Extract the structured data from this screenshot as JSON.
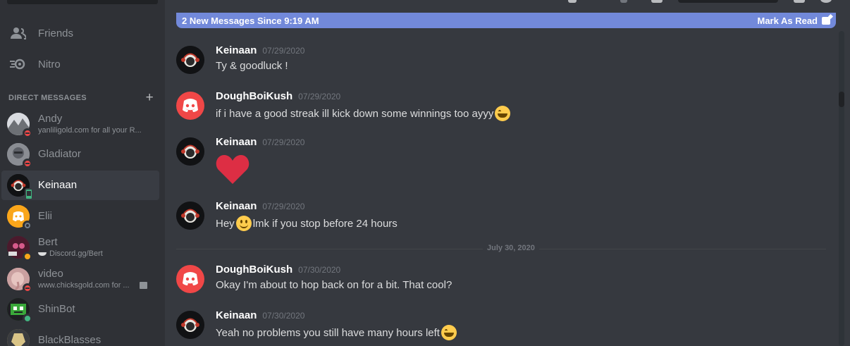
{
  "sidebar": {
    "nav": [
      {
        "label": "Friends",
        "icon": "friends-icon"
      },
      {
        "label": "Nitro",
        "icon": "nitro-icon"
      }
    ],
    "dm_header": "DIRECT MESSAGES",
    "dms": [
      {
        "name": "Andy",
        "sub": "yanliligold.com for all your R...",
        "status": "dnd",
        "avatar_color": "#c9ccd1"
      },
      {
        "name": "Gladiator",
        "sub": "",
        "status": "dnd",
        "avatar_color": "#7b7f87"
      },
      {
        "name": "Keinaan",
        "sub": "",
        "status": "mobile",
        "avatar_color": "#111214"
      },
      {
        "name": "Elii",
        "sub": "",
        "status": "offline",
        "avatar_color": "#faa61a"
      },
      {
        "name": "Bert",
        "sub": "Discord.gg/Bert",
        "status": "idle",
        "avatar_color": "#6a2840"
      },
      {
        "name": "video",
        "sub": "www.chicksgold.com for ...",
        "status": "dnd",
        "avatar_color": "#d9a4a4"
      },
      {
        "name": "ShinBot",
        "sub": "",
        "status": "online",
        "avatar_color": "#2d6b2d"
      },
      {
        "name": "BlackBlasses",
        "sub": "",
        "status": "none",
        "avatar_color": "#c9b36a"
      }
    ]
  },
  "chat": {
    "new_messages_text": "2 New Messages Since 9:19 AM",
    "mark_as_read": "Mark As Read",
    "date_divider": "July 30, 2020",
    "messages": [
      {
        "author": "Keinaan",
        "timestamp": "07/29/2020",
        "text": "Ty & goodluck !",
        "emoji": ""
      },
      {
        "author": "DoughBoiKush",
        "timestamp": "07/29/2020",
        "text": "if i have a good streak ill kick down some winnings too ayyy",
        "emoji": "grin"
      },
      {
        "author": "Keinaan",
        "timestamp": "07/29/2020",
        "text": "",
        "emoji": "heart"
      },
      {
        "author": "Keinaan",
        "timestamp": "07/29/2020",
        "text_before": "Hey",
        "text": "lmk if you stop before 24 hours",
        "emoji": "smile"
      },
      {
        "author": "DoughBoiKush",
        "timestamp": "07/30/2020",
        "text": "Okay I'm about to hop back on for a bit. That cool?",
        "emoji": ""
      },
      {
        "author": "Keinaan",
        "timestamp": "07/30/2020",
        "text": "Yeah no problems you still have many hours left",
        "emoji": "grin"
      }
    ]
  },
  "colors": {
    "blurple": "#7289da",
    "dnd": "#f04747",
    "online": "#43b581",
    "idle": "#faa61a",
    "sidebar_bg": "#2f3136",
    "chat_bg": "#36393f"
  }
}
